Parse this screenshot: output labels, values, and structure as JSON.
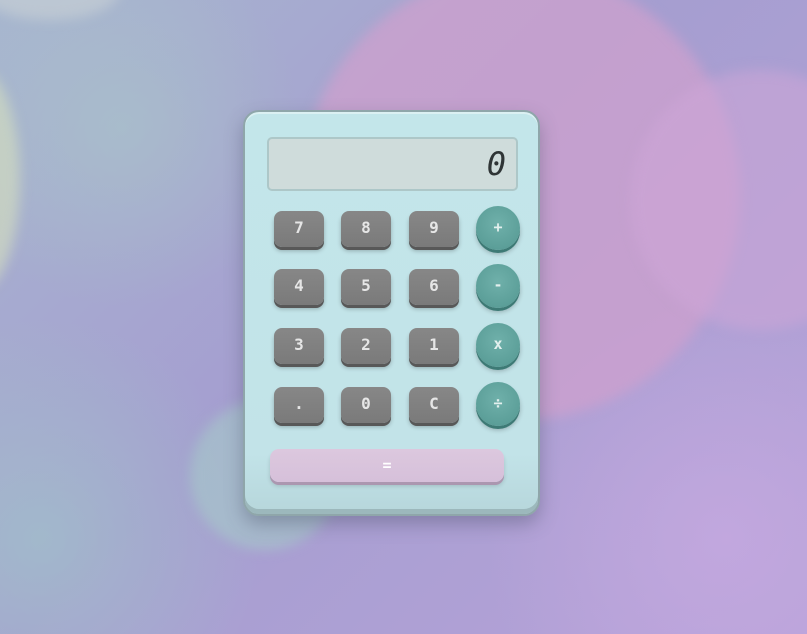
{
  "calculator": {
    "display": {
      "value": "0"
    },
    "keys": {
      "seven": "7",
      "eight": "8",
      "nine": "9",
      "four": "4",
      "five": "5",
      "six": "6",
      "three": "3",
      "two": "2",
      "one": "1",
      "decimal": ".",
      "zero": "0",
      "clear": "C"
    },
    "operators": {
      "add": "+",
      "subtract": "-",
      "multiply": "x",
      "divide": "÷"
    },
    "equals": "="
  },
  "colors": {
    "body": "#c3e6ea",
    "display": "#cfdcdb",
    "digit_key": "#808080",
    "operator_key": "#5c9f99",
    "equals_key": "#d9c4dc",
    "background_pink": "#cda0cd",
    "background_purple": "#a9a3cf"
  }
}
